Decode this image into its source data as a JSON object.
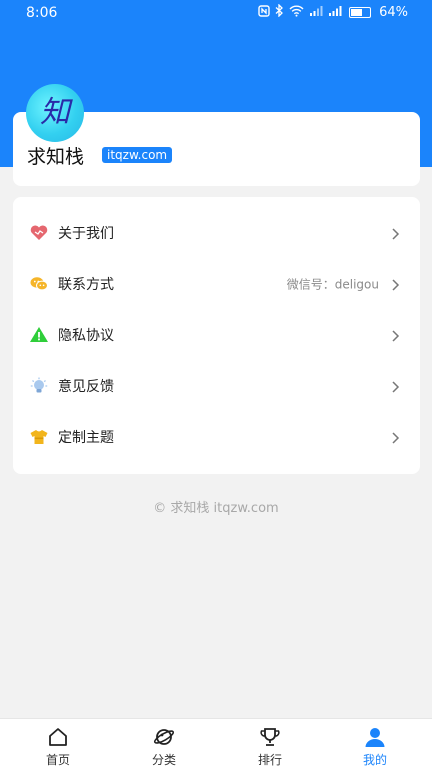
{
  "status_bar": {
    "time": "8:06",
    "battery_percent": "64%",
    "battery_level": 0.64,
    "icons": [
      "nfc-icon",
      "bluetooth-icon",
      "wifi-icon",
      "signal-icon",
      "signal-icon",
      "battery-icon"
    ]
  },
  "profile": {
    "avatar_char": "知",
    "name": "求知栈",
    "site": "itqzw.com"
  },
  "menu": {
    "items": [
      {
        "label": "关于我们",
        "value": "",
        "icon": "heart-icon"
      },
      {
        "label": "联系方式",
        "value": "微信号：deligou",
        "icon": "wechat-icon"
      },
      {
        "label": "隐私协议",
        "value": "",
        "icon": "warning-icon"
      },
      {
        "label": "意见反馈",
        "value": "",
        "icon": "lightbulb-icon"
      },
      {
        "label": "定制主题",
        "value": "",
        "icon": "shirt-icon"
      }
    ]
  },
  "footer": {
    "copyright": "© 求知栈 itqzw.com"
  },
  "tabs": [
    {
      "label": "首页",
      "icon": "home-icon",
      "active": false
    },
    {
      "label": "分类",
      "icon": "planet-icon",
      "active": false
    },
    {
      "label": "排行",
      "icon": "trophy-icon",
      "active": false
    },
    {
      "label": "我的",
      "icon": "user-icon",
      "active": true
    }
  ],
  "colors": {
    "accent": "#1b84fb",
    "background": "#f2f2f2"
  }
}
